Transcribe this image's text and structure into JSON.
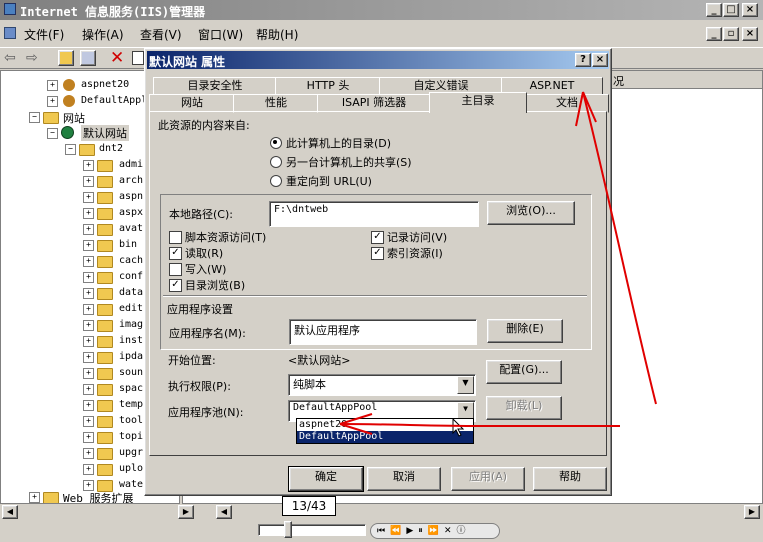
{
  "window": {
    "title": "Internet 信息服务(IIS)管理器",
    "min": "_",
    "max": "□",
    "close": "×"
  },
  "menu": [
    {
      "label": "文件(F)"
    },
    {
      "label": "操作(A)"
    },
    {
      "label": "查看(V)"
    },
    {
      "label": "窗口(W)"
    },
    {
      "label": "帮助(H)"
    }
  ],
  "mdi_controls": {
    "min": "_",
    "restore": "▫",
    "close": "×"
  },
  "right_pane": {
    "column_header_fragment": "况"
  },
  "tree": {
    "top_items": [
      {
        "label": "aspnet20"
      },
      {
        "label": "DefaultAppl"
      }
    ],
    "sites_label": "网站",
    "default_site": "默认网站",
    "dnt2": "dnt2",
    "children": [
      {
        "label": "admi"
      },
      {
        "label": "arch"
      },
      {
        "label": "aspn"
      },
      {
        "label": "aspx"
      },
      {
        "label": "avat"
      },
      {
        "label": "bin"
      },
      {
        "label": "cach"
      },
      {
        "label": "conf"
      },
      {
        "label": "data"
      },
      {
        "label": "edit"
      },
      {
        "label": "imag"
      },
      {
        "label": "inst"
      },
      {
        "label": "ipda"
      },
      {
        "label": "soun"
      },
      {
        "label": "spac"
      },
      {
        "label": "temp"
      },
      {
        "label": "tool"
      },
      {
        "label": "topi"
      },
      {
        "label": "upgr"
      },
      {
        "label": "uplo"
      },
      {
        "label": "wate"
      }
    ],
    "web_ext": "Web 服务扩展"
  },
  "dialog": {
    "title": "默认网站 属性",
    "help": "?",
    "close": "×",
    "tabs_row1": [
      {
        "label": "目录安全性"
      },
      {
        "label": "HTTP 头"
      },
      {
        "label": "自定义错误"
      },
      {
        "label": "ASP.NET"
      }
    ],
    "tabs_row2": [
      {
        "label": "网站"
      },
      {
        "label": "性能"
      },
      {
        "label": "ISAPI 筛选器"
      },
      {
        "label": "主目录"
      },
      {
        "label": "文档"
      }
    ],
    "source_label": "此资源的内容来自:",
    "radios": [
      {
        "label": "此计算机上的目录(D)",
        "checked": true
      },
      {
        "label": "另一台计算机上的共享(S)",
        "checked": false
      },
      {
        "label": "重定向到 URL(U)",
        "checked": false
      }
    ],
    "local_path_label": "本地路径(C):",
    "local_path_value": "F:\\dntweb",
    "browse_button": "浏览(O)...",
    "checks_left": [
      {
        "label": "脚本资源访问(T)",
        "checked": false
      },
      {
        "label": "读取(R)",
        "checked": true
      },
      {
        "label": "写入(W)",
        "checked": false
      },
      {
        "label": "目录浏览(B)",
        "checked": true
      }
    ],
    "checks_right": [
      {
        "label": "记录访问(V)",
        "checked": true
      },
      {
        "label": "索引资源(I)",
        "checked": true
      }
    ],
    "app_settings_label": "应用程序设置",
    "app_name_label": "应用程序名(M):",
    "app_name_value": "默认应用程序",
    "remove_button": "删除(E)",
    "start_label": "开始位置:",
    "start_value": "<默认网站>",
    "config_button": "配置(G)...",
    "exec_label": "执行权限(P):",
    "exec_value": "纯脚本",
    "pool_label": "应用程序池(N):",
    "pool_value": "DefaultAppPool",
    "unload_button": "卸载(L)",
    "pool_options": [
      "aspnet20",
      "DefaultAppPool"
    ],
    "ok": "确定",
    "cancel": "取消",
    "apply": "应用(A)",
    "help_button": "帮助"
  },
  "status": {
    "page": "13/43"
  },
  "colors": {
    "annotation": "#e00000",
    "selection": "#0a246a"
  }
}
